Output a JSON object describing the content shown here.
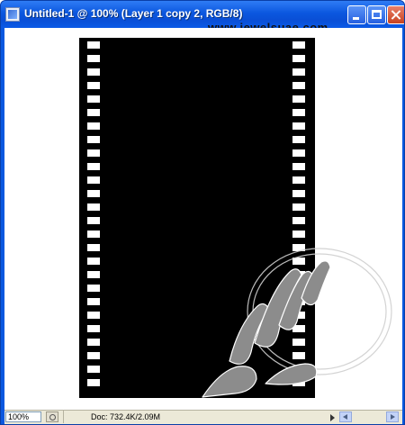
{
  "window": {
    "title": "Untitled-1 @ 100% (Layer 1 copy 2, RGB/8)",
    "watermark_url": "www.jewelsuae.com",
    "controls": {
      "minimize": "minimize-icon",
      "maximize": "maximize-icon",
      "close": "close-icon"
    },
    "colors": {
      "titlebar": "#0b57df",
      "canvas_bg": "#ffffff",
      "film": "#000000"
    }
  },
  "canvas": {
    "film_strip": {
      "left_holes": 26,
      "right_holes": 26
    }
  },
  "statusbar": {
    "zoom": "100%",
    "doc_info": "Doc: 732.4K/2.09M"
  }
}
